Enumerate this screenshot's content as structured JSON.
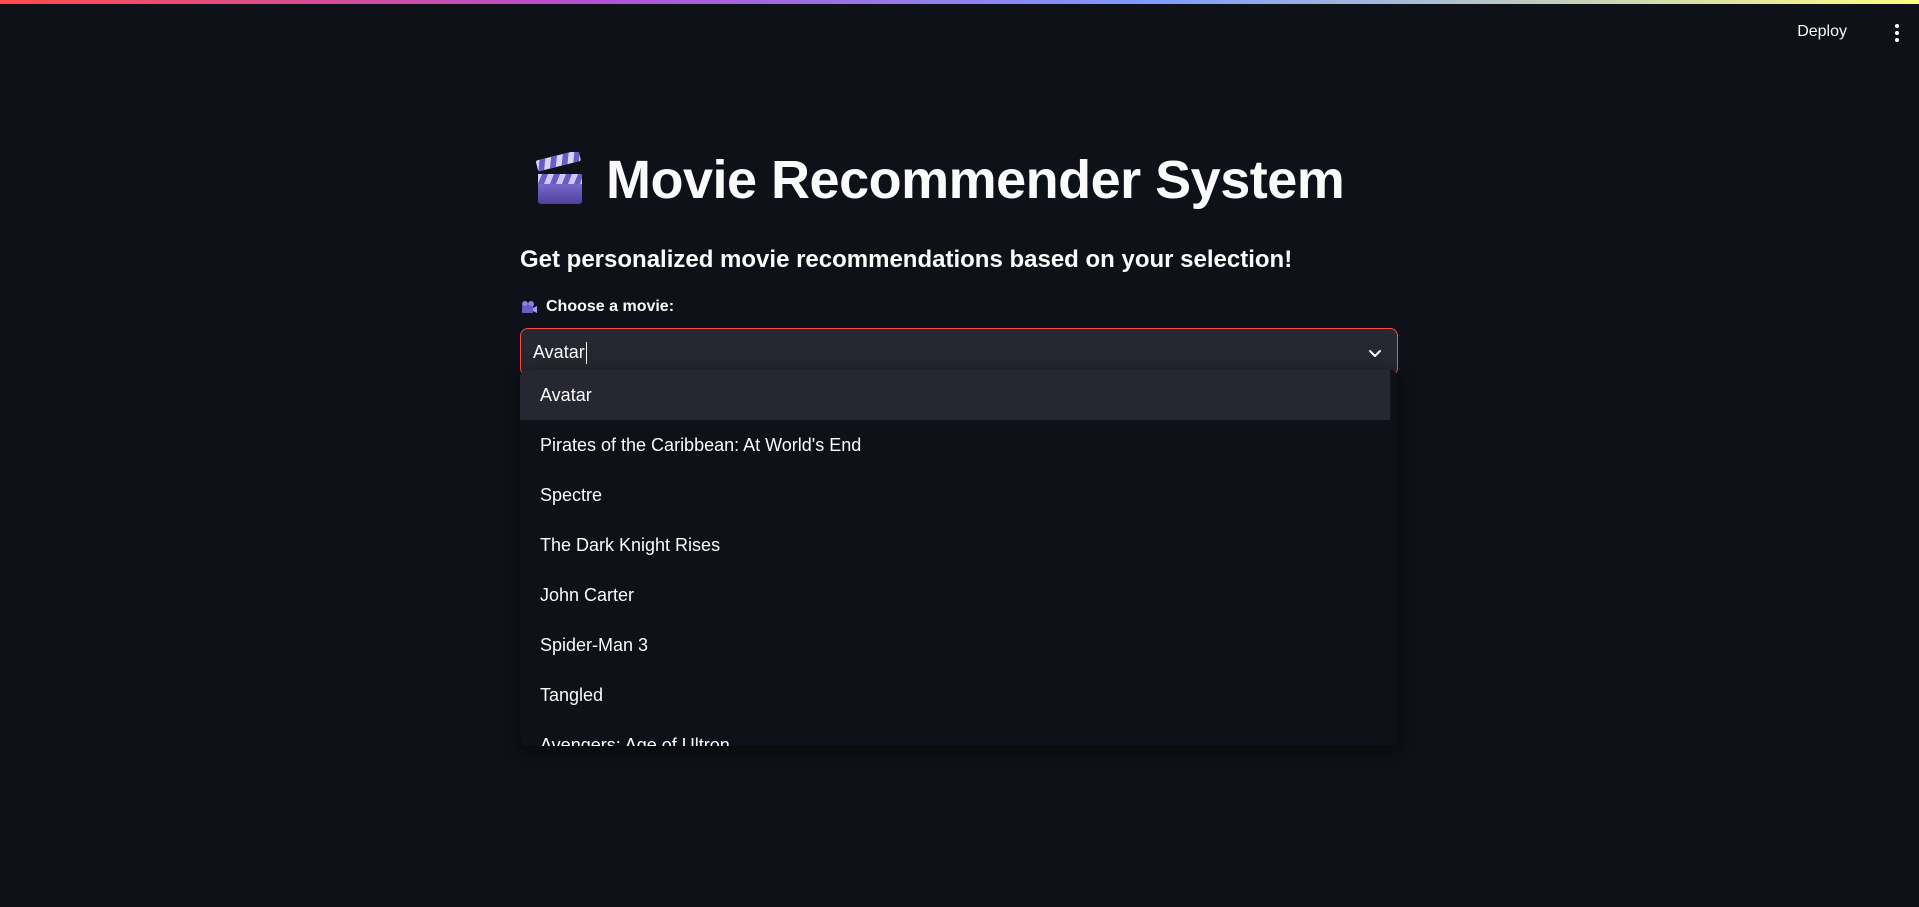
{
  "header": {
    "deploy_label": "Deploy",
    "menu_icon": "more-vertical-icon"
  },
  "main": {
    "title_icon": "clapper-board-icon",
    "title": "Movie Recommender System",
    "subtitle": "Get personalized movie recommendations based on your selection!",
    "select": {
      "label_icon": "movie-camera-icon",
      "label": "Choose a movie:",
      "value": "Avatar",
      "options": [
        "Avatar",
        "Pirates of the Caribbean: At World's End",
        "Spectre",
        "The Dark Knight Rises",
        "John Carter",
        "Spider-Man 3",
        "Tangled",
        "Avengers: Age of Ultron"
      ],
      "highlighted_index": 0
    }
  },
  "colors": {
    "background": "#0e1117",
    "input_bg": "#262730",
    "focus_border": "#ff4b4b",
    "text": "#fafafa"
  }
}
